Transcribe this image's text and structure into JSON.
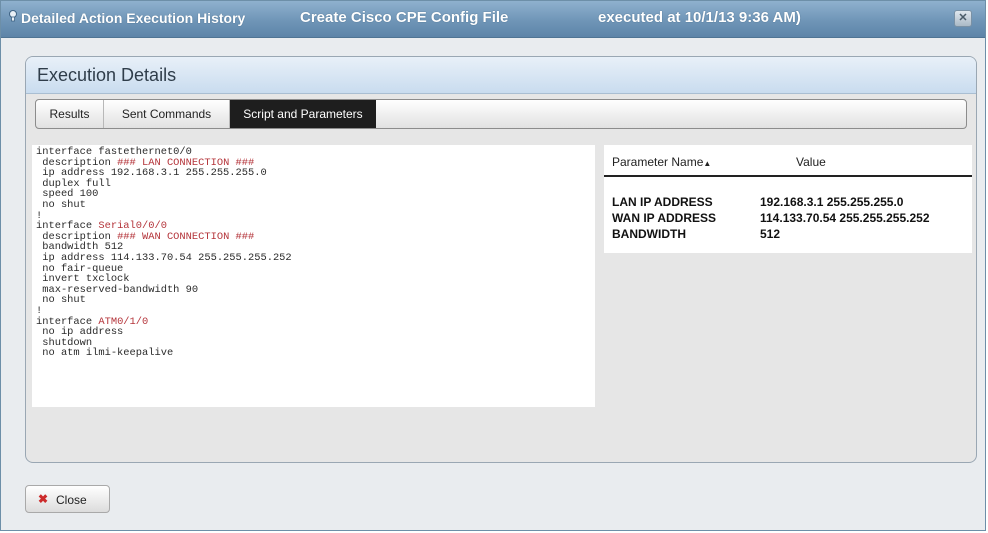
{
  "window": {
    "title": "Detailed Action Execution History",
    "action_name": "Create Cisco CPE Config File",
    "executed_at": "executed at 10/1/13 9:36 AM)",
    "close_icon": "close-x-icon"
  },
  "panel": {
    "title": "Execution Details"
  },
  "tabs": [
    {
      "label": "Results"
    },
    {
      "label": "Sent Commands"
    },
    {
      "label": "Script and Parameters",
      "active": true
    }
  ],
  "script_lines": [
    [
      {
        "t": "interface fastethernet0/0"
      }
    ],
    [
      {
        "t": " description "
      },
      {
        "t": "### LAN CONNECTION ###",
        "kw": true
      }
    ],
    [
      {
        "t": " ip address 192.168.3.1 255.255.255.0"
      }
    ],
    [
      {
        "t": " duplex full"
      }
    ],
    [
      {
        "t": " speed 100"
      }
    ],
    [
      {
        "t": " no shut"
      }
    ],
    [
      {
        "t": "!"
      }
    ],
    [
      {
        "t": "interface "
      },
      {
        "t": "Serial0/0/0",
        "kw": true
      }
    ],
    [
      {
        "t": " description "
      },
      {
        "t": "### WAN CONNECTION ###",
        "kw": true
      }
    ],
    [
      {
        "t": " bandwidth 512"
      }
    ],
    [
      {
        "t": " ip address 114.133.70.54 255.255.255.252"
      }
    ],
    [
      {
        "t": " no fair-queue"
      }
    ],
    [
      {
        "t": " invert txclock"
      }
    ],
    [
      {
        "t": " max-reserved-bandwidth 90"
      }
    ],
    [
      {
        "t": " no shut"
      }
    ],
    [
      {
        "t": "!"
      }
    ],
    [
      {
        "t": "interface "
      },
      {
        "t": "ATM0/1/0",
        "kw": true
      }
    ],
    [
      {
        "t": " no ip address"
      }
    ],
    [
      {
        "t": " shutdown"
      }
    ],
    [
      {
        "t": " no atm ilmi-keepalive"
      }
    ]
  ],
  "params_table": {
    "col_name": "Parameter Name",
    "col_name_sort_icon": "sort-ascending-icon",
    "col_value": "Value",
    "rows": [
      {
        "name": "LAN IP ADDRESS",
        "value": "192.168.3.1 255.255.255.0"
      },
      {
        "name": "WAN IP ADDRESS",
        "value": "114.133.70.54 255.255.255.252"
      },
      {
        "name": "BANDWIDTH",
        "value": "512"
      }
    ]
  },
  "footer": {
    "close_label": "Close",
    "close_icon": "x-icon"
  }
}
